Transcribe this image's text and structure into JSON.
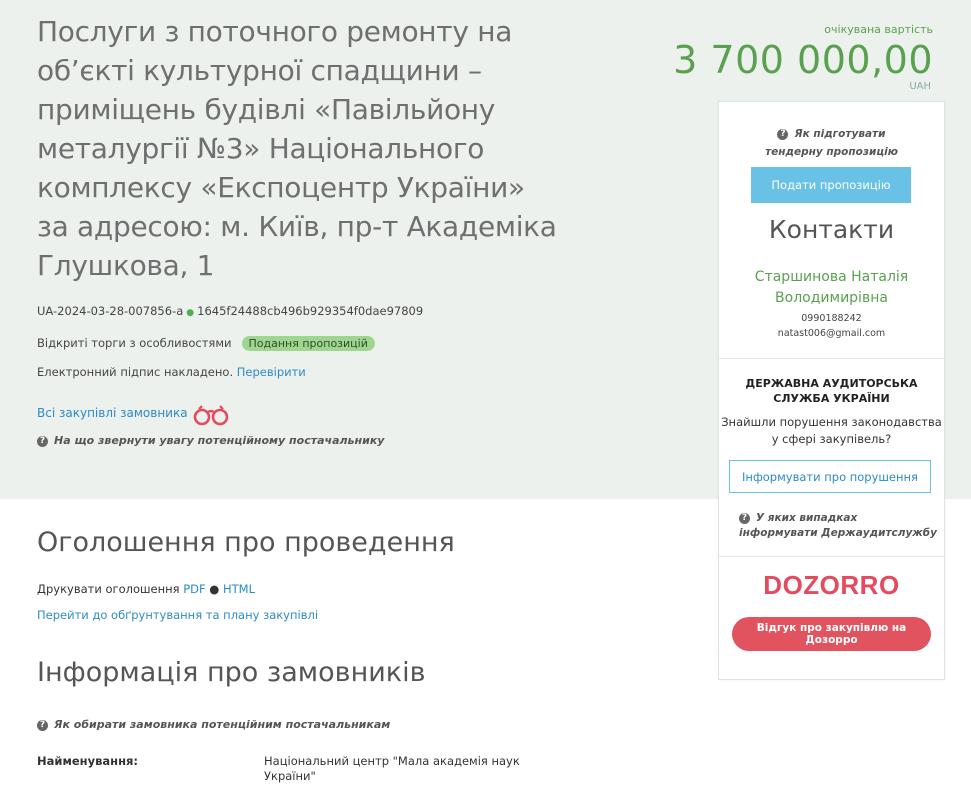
{
  "tender": {
    "title": "Послуги з поточного ремонту на об’єкті культурної спадщини – приміщень будівлі «Павільйону металургії №3» Національного комплексу «Експоцентр України» за адресою: м. Київ, пр-т Академіка Глушкова, 1",
    "id": "UA-2024-03-28-007856-a",
    "hash": "1645f24488cb496b929354f0dae97809",
    "procedure": "Відкриті торги з особливостями",
    "status": "Подання пропозицій",
    "signature_text": "Електронний підпис накладено.",
    "verify_link": "Перевірити",
    "all_purchases_link": "Всі закупівлі замовника",
    "hint": "На що звернути увагу потенційному постачальнику"
  },
  "expected": {
    "label": "очікувана вартість",
    "value": "3 700 000,00",
    "currency": "UAH"
  },
  "sidebar": {
    "prepare_hint": "Як підготувати тендерну пропозицію",
    "submit_button": "Подати пропозицію",
    "contacts_title": "Контакти",
    "contact_name": "Старшинова Наталія Володимирівна",
    "phone": "0990188242",
    "email": "natast006@gmail.com",
    "audit_title": "ДЕРЖАВНА АУДИТОРСЬКА СЛУЖБА УКРАЇНИ",
    "audit_question": "Знайшли порушення законодавства у сфері закупівель?",
    "inform_button": "Інформувати про порушення",
    "audit_hint": "У яких випадках інформувати Держаудитслужбу",
    "dozorro_logo": "DOZORRO",
    "dozorro_button": "Відгук про закупівлю на Дозорро"
  },
  "announcement": {
    "heading": "Оголошення про проведення",
    "print_label": "Друкувати оголошення",
    "pdf": "PDF",
    "html": "HTML",
    "plan_link": "Перейти до обґрунтування та плану закупівлі"
  },
  "customers": {
    "heading": "Інформація про замовників",
    "hint": "Як обирати замовника потенційним постачальникам",
    "name_label": "Найменування:",
    "name_value": "Національний центр \"Мала академія наук України\""
  },
  "colors": {
    "accent_green": "#5aa14f",
    "link_blue": "#2d8bc4",
    "button_blue": "#6ac1e6",
    "dozorro_red": "#e54b5e",
    "hero_bg": "#edf1ee"
  }
}
